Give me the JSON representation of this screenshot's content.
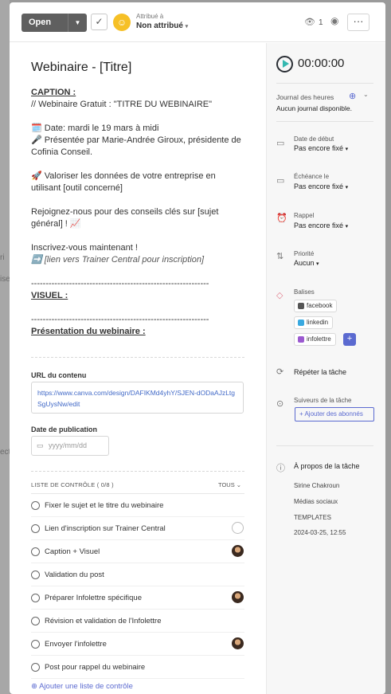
{
  "background": {
    "cut_text": [
      "ri",
      "ise",
      "ect"
    ]
  },
  "topbar": {
    "status_label": "Open",
    "assign_small": "Attribué à",
    "assign_value": "Non attribué",
    "watchers": "1"
  },
  "task": {
    "title": "Webinaire - [Titre]",
    "caption_heading": "CAPTION :",
    "line1": "// Webinaire Gratuit : \"TITRE DU WEBINAIRE\"",
    "date_line": "🗓️ Date: mardi le 19 mars à midi",
    "presenter_line": "🎤 Présentée par Marie-Andrée Giroux, présidente de Cofinia Conseil.",
    "value_line": "🚀 Valoriser les données de votre entreprise en utilisant [outil concerné]",
    "join_line": "Rejoignez-nous pour des conseils clés sur [sujet général] ! 📈",
    "signup_line": "Inscrivez-vous maintenant !",
    "link_line": "➡️ [lien vers Trainer Central pour inscription]",
    "dash_line": "-------------------------------------------------------------",
    "visual_heading": "VISUEL :",
    "dash_line2": "-------------------------------------------------------------",
    "presentation_heading": "Présentation du webinaire :"
  },
  "fields": {
    "url_label": "URL du contenu",
    "url_value": "https://www.canva.com/design/DAFIKMd4yhY/SJEN-dODaAJzLtgSgUysNw/edit",
    "pub_label": "Date de publication",
    "pub_placeholder": "yyyy/mm/dd"
  },
  "checklist": {
    "header": "LISTE DE CONTRÔLE  ( 0/8 )",
    "filter": "TOUS ⌄",
    "items": [
      {
        "label": "Fixer le sujet et le titre du webinaire"
      },
      {
        "label": "Lien d'inscription sur Trainer Central"
      },
      {
        "label": "Caption + Visuel"
      },
      {
        "label": "Validation du post"
      },
      {
        "label": "Préparer Infolettre spécifique"
      },
      {
        "label": "Révision et validation de l'Infolettre"
      },
      {
        "label": "Envoyer l'infolettre"
      },
      {
        "label": "Post pour rappel du webinaire"
      }
    ],
    "add_label": "Ajouter une liste de contrôle"
  },
  "sidebar": {
    "timer": "00:00:00",
    "timelog_label": "Journal des heures",
    "timelog_empty": "Aucun journal disponible.",
    "start_label": "Date de début",
    "start_value": "Pas encore fixé",
    "due_label": "Échéance le",
    "due_value": "Pas encore fixé",
    "reminder_label": "Rappel",
    "reminder_value": "Pas encore fixé",
    "priority_label": "Priorité",
    "priority_value": "Aucun",
    "tags_label": "Balises",
    "tags": [
      {
        "name": "facebook",
        "color": "#555555"
      },
      {
        "name": "linkedin",
        "color": "#39a9e0"
      },
      {
        "name": "infolettre",
        "color": "#9b59d0"
      }
    ],
    "repeat_label": "Répéter la tâche",
    "followers_label": "Suiveurs de la tâche",
    "add_followers": "Ajouter des abonnés",
    "about_title": "À propos de la tâche",
    "about_lines": [
      "Sirine Chakroun",
      "Médias sociaux",
      "TEMPLATES",
      "2024-03-25, 12:55"
    ]
  },
  "colors": {
    "accent": "#5b6ad0",
    "timer_play": "#34b8b0",
    "assignee": "#f6c026"
  }
}
